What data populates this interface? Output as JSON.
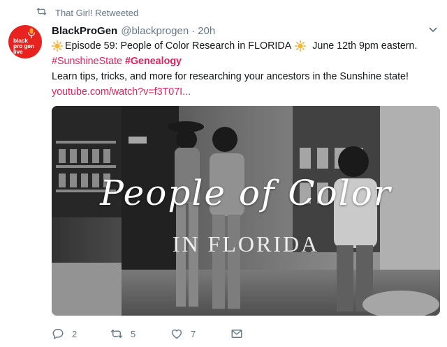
{
  "retweet_banner": {
    "icon": "retweet-icon",
    "text": "That Girl! Retweeted"
  },
  "tweet": {
    "avatar": {
      "logo_text": [
        "black",
        "pro gen",
        "live"
      ],
      "icon": "microphone-icon",
      "color": "#e8231f"
    },
    "author_name": "BlackProGen",
    "handle": "@blackprogen",
    "separator": "·",
    "time": "20h",
    "line1_pre": "Episode 59: People of Color Research in FLORIDA",
    "line1_post": "June 12th 9pm eastern.",
    "hashtag1": "#SunshineState",
    "hashtag2": "#Genealogy",
    "line3": "Learn tips, tricks, and more for researching your ancestors in the Sunshine state!",
    "link": "youtube.com/watch?v=f3T07I...",
    "media": {
      "title": "People of Color",
      "subtitle": "IN FLORIDA"
    }
  },
  "actions": {
    "reply_count": "2",
    "retweet_count": "5",
    "like_count": "7"
  },
  "colors": {
    "accent": "#e0245e",
    "muted": "#657786",
    "text": "#14171a"
  }
}
